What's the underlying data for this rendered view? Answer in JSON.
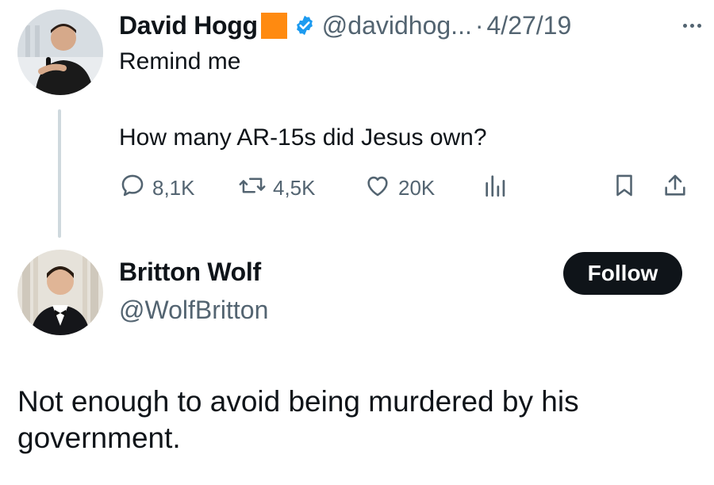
{
  "original_tweet": {
    "author_name": "David Hogg",
    "handle": "@davidhog...",
    "separator": "·",
    "date": "4/27/19",
    "more_icon": "more-horizontal-icon",
    "badge_color": "#ff8a10",
    "verified_color": "#1d9bf0",
    "text_line1": "Remind me",
    "text_line2": "How many AR-15s did Jesus own?",
    "actions": {
      "replies": "8,1K",
      "retweets": "4,5K",
      "likes": "20K"
    }
  },
  "reply": {
    "author_name": "Britton Wolf",
    "handle": "@WolfBritton",
    "follow_label": "Follow",
    "text": "Not enough to avoid being murdered by his government."
  }
}
